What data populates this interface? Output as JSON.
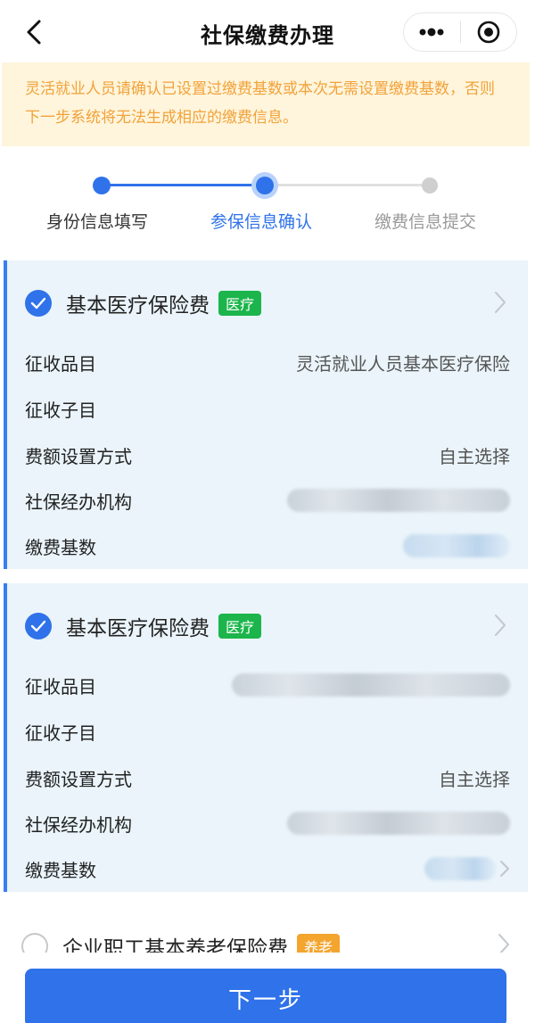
{
  "header": {
    "title": "社保缴费办理",
    "back_icon": "chevron-left-icon",
    "more_icon": "more-dots-icon",
    "close_icon": "target-circle-icon"
  },
  "notice": {
    "text": "灵活就业人员请确认已设置过缴费基数或本次无需设置缴费基数，否则下一步系统将无法生成相应的缴费信息。"
  },
  "steps": [
    {
      "label": "身份信息填写",
      "state": "done"
    },
    {
      "label": "参保信息确认",
      "state": "active"
    },
    {
      "label": "缴费信息提交",
      "state": "pending"
    }
  ],
  "cards": [
    {
      "title": "基本医疗保险费",
      "tag": "医疗",
      "checked": true,
      "rows": {
        "item_label": "征收品目",
        "item_value": "灵活就业人员基本医疗保险",
        "subitem_label": "征收子目",
        "method_label": "费额设置方式",
        "method_value": "自主选择",
        "agency_label": "社保经办机构",
        "base_label": "缴费基数"
      }
    },
    {
      "title": "基本医疗保险费",
      "tag": "医疗",
      "checked": true,
      "rows": {
        "item_label": "征收品目",
        "subitem_label": "征收子目",
        "method_label": "费额设置方式",
        "method_value": "自主选择",
        "agency_label": "社保经办机构",
        "base_label": "缴费基数"
      }
    }
  ],
  "partial_card": {
    "title": "企业职工基本养老保险费",
    "tag": "养老",
    "checked": false
  },
  "footer": {
    "next_label": "下一步"
  },
  "colors": {
    "primary": "#2f72ea",
    "notice_bg": "#fff5dc",
    "notice_text": "#f2a23a",
    "card_bg": "#eaf4fa",
    "tag_green": "#1bb54b",
    "tag_orange": "#f3a52e"
  }
}
